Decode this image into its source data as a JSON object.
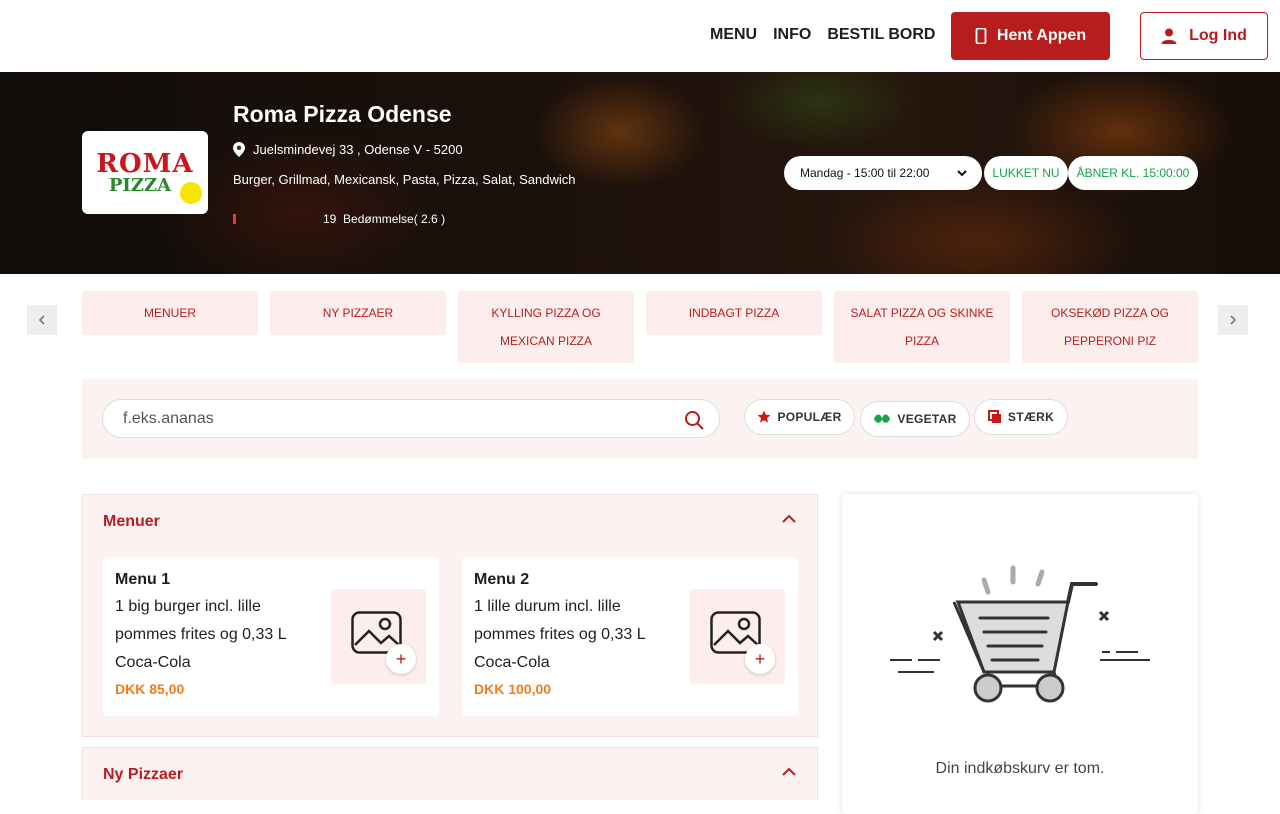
{
  "header": {
    "nav": [
      {
        "label": "MENU"
      },
      {
        "label": "INFO"
      },
      {
        "label": "BESTIL BORD"
      }
    ],
    "app_button": "Hent Appen",
    "login_button": "Log Ind",
    "accent_color": "#b81d1d"
  },
  "restaurant": {
    "logo_text_1": "ROMA",
    "logo_text_2": "PIZZA",
    "name": "Roma Pizza Odense",
    "address": "Juelsmindevej 33 , Odense V - 5200",
    "cuisines": "Burger, Grillmad, Mexicansk, Pasta, Pizza, Salat, Sandwich",
    "reviews_count": "19",
    "rating_text": "Bedømmelse( 2.6 )",
    "hours_selected": "Mandag - 15:00 til 22:00",
    "status_closed": "LUKKET NU",
    "opens_at": "ÅBNER KL. 15:00:00"
  },
  "categories": [
    {
      "label": "MENUER"
    },
    {
      "label": "NY PIZZAER"
    },
    {
      "label": "KYLLING PIZZA OG MEXICAN PIZZA"
    },
    {
      "label": "INDBAGT PIZZA"
    },
    {
      "label": "SALAT PIZZA OG SKINKE PIZZA"
    },
    {
      "label": "OKSEKØD PIZZA OG PEPPERONI PIZ"
    }
  ],
  "search": {
    "placeholder": "f.eks.ananas",
    "filters": [
      {
        "label": "POPULÆR",
        "icon": "star-icon"
      },
      {
        "label": "VEGETAR",
        "icon": "leaf-icon"
      },
      {
        "label": "STÆRK",
        "icon": "chili-icon"
      }
    ]
  },
  "sections": [
    {
      "title": "Menuer",
      "items": [
        {
          "name": "Menu 1",
          "description": "1 big burger incl. lille pommes frites og 0,33 L Coca-Cola",
          "price": "DKK 85,00"
        },
        {
          "name": "Menu 2",
          "description": "1 lille durum incl. lille pommes frites og 0,33 L Coca-Cola",
          "price": "DKK 100,00"
        }
      ]
    },
    {
      "title": "Ny Pizzaer",
      "items": []
    }
  ],
  "cart": {
    "empty_text": "Din indkøbskurv er tom."
  }
}
